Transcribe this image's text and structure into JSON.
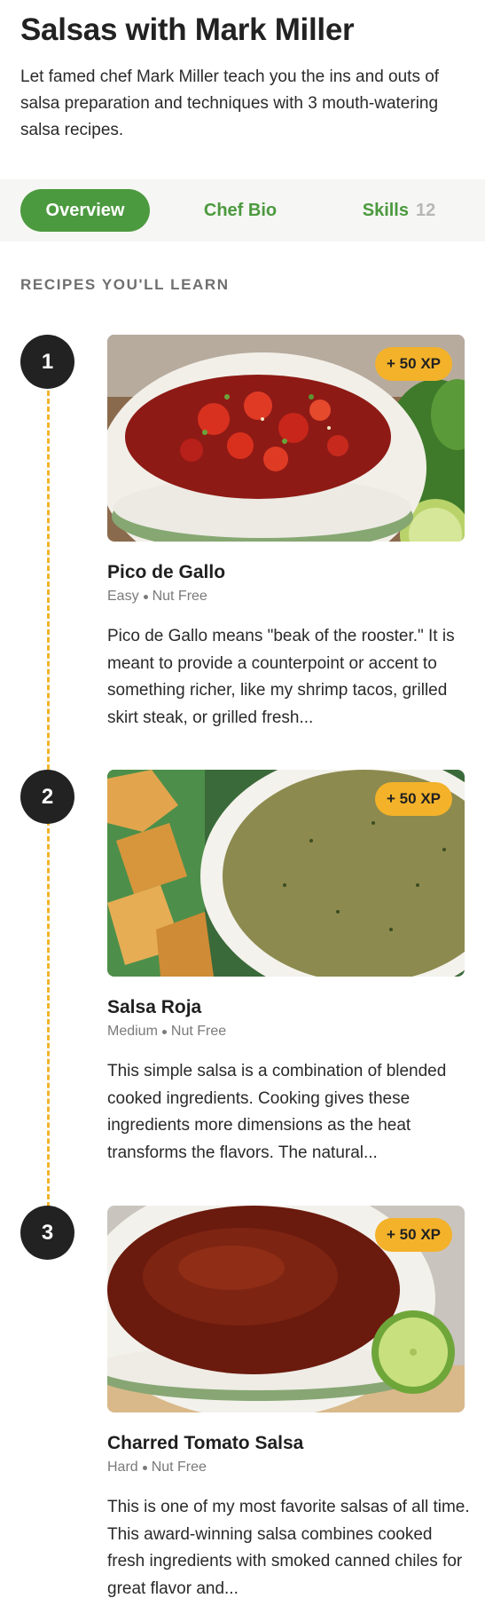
{
  "header": {
    "title": "Salsas with Mark Miller",
    "description": "Let famed chef Mark Miller teach you the ins and outs of salsa preparation and techniques with 3 mouth-watering salsa recipes."
  },
  "tabs": [
    {
      "label": "Overview",
      "active": true
    },
    {
      "label": "Chef Bio",
      "active": false
    },
    {
      "label": "Skills",
      "count": "12",
      "active": false
    }
  ],
  "section_label": "RECIPES YOU'LL LEARN",
  "recipes": [
    {
      "number": "1",
      "xp": "+ 50 XP",
      "title": "Pico de Gallo",
      "difficulty": "Easy",
      "diet": "Nut Free",
      "description": "Pico de Gallo means \"beak of the rooster.\" It is meant to provide a counterpoint or accent to something richer, like my shrimp tacos, grilled skirt steak, or grilled fresh...",
      "image": "pico-de-gallo-photo"
    },
    {
      "number": "2",
      "xp": "+ 50 XP",
      "title": "Salsa Roja",
      "difficulty": "Medium",
      "diet": "Nut Free",
      "description": "This simple salsa is a combination of blended cooked ingredients. Cooking gives these ingredients more dimensions as the heat transforms the flavors. The natural...",
      "image": "salsa-roja-photo"
    },
    {
      "number": "3",
      "xp": "+ 50 XP",
      "title": "Charred Tomato Salsa",
      "difficulty": "Hard",
      "diet": "Nut Free",
      "description": "This is one of my most favorite salsas of all time. This award-winning salsa combines cooked fresh ingredients with smoked canned chiles for great flavor and...",
      "image": "charred-tomato-salsa-photo"
    }
  ],
  "colors": {
    "accent_green": "#4c9a3f",
    "xp_badge": "#f3b22a",
    "timeline": "#f0b429",
    "step_circle": "#222222"
  }
}
